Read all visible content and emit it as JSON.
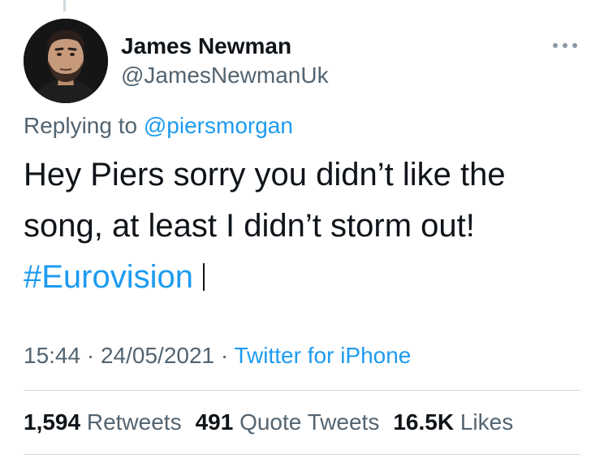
{
  "author": {
    "display_name": "James Newman",
    "handle": "@JamesNewmanUk"
  },
  "more_icon": "more-horizontal-icon",
  "reply": {
    "prefix": "Replying to ",
    "target": "@piersmorgan"
  },
  "tweet": {
    "text_line1": "Hey Piers sorry you didn’t like the",
    "text_line2": "song, at least I didn’t storm out!",
    "hashtag": "#Eurovision"
  },
  "meta": {
    "time": "15:44",
    "separator": " · ",
    "date": "24/05/2021",
    "source": "Twitter for iPhone"
  },
  "stats": {
    "retweets_count": "1,594",
    "retweets_label": "Retweets",
    "quote_count": "491",
    "quote_label": "Quote Tweets",
    "likes_count": "16.5K",
    "likes_label": "Likes"
  },
  "colors": {
    "link": "#1d9bf0",
    "secondary_text": "#536471",
    "primary_text": "#0f1419",
    "divider": "#cfd9de"
  }
}
